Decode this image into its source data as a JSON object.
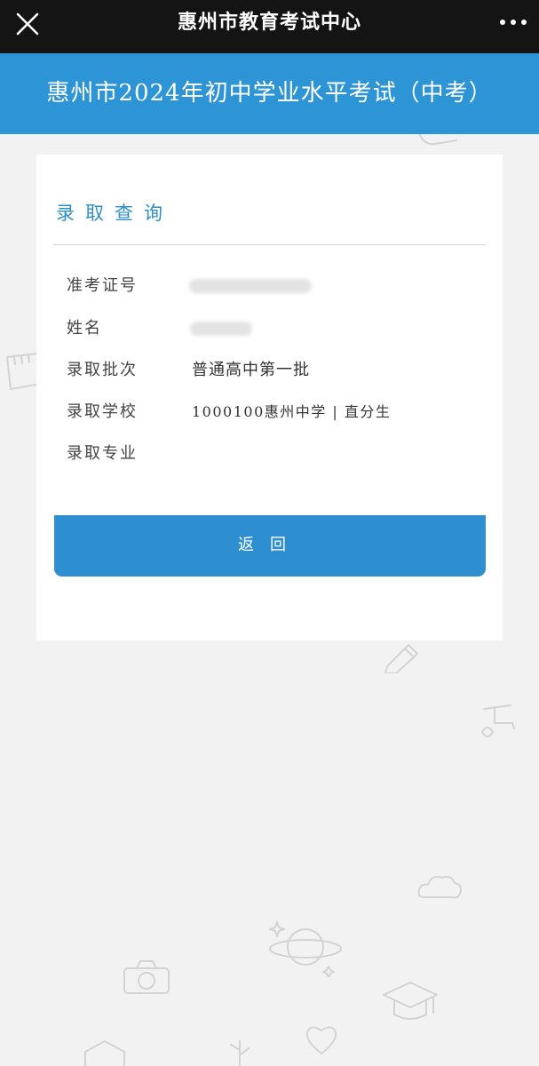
{
  "nav": {
    "title": "惠州市教育考试中心",
    "close_icon": "close-icon",
    "more_icon": "more-dots-icon"
  },
  "banner": {
    "title": "惠州市2024年初中学业水平考试（中考）"
  },
  "card": {
    "heading": "录取查询",
    "rows": [
      {
        "label": "准考证号",
        "value": ""
      },
      {
        "label": "姓名",
        "value": ""
      },
      {
        "label": "录取批次",
        "value": "普通高中第一批"
      },
      {
        "label": "录取学校",
        "value": "1000100惠州中学 | 直分生"
      },
      {
        "label": "录取专业",
        "value": ""
      }
    ],
    "return_label": "返回"
  },
  "colors": {
    "nav_bg": "#141414",
    "banner_bg": "#2d94d6",
    "heading": "#2d8fc6",
    "button_bg": "#2d8fd0",
    "page_bg": "#f2f2f2"
  }
}
